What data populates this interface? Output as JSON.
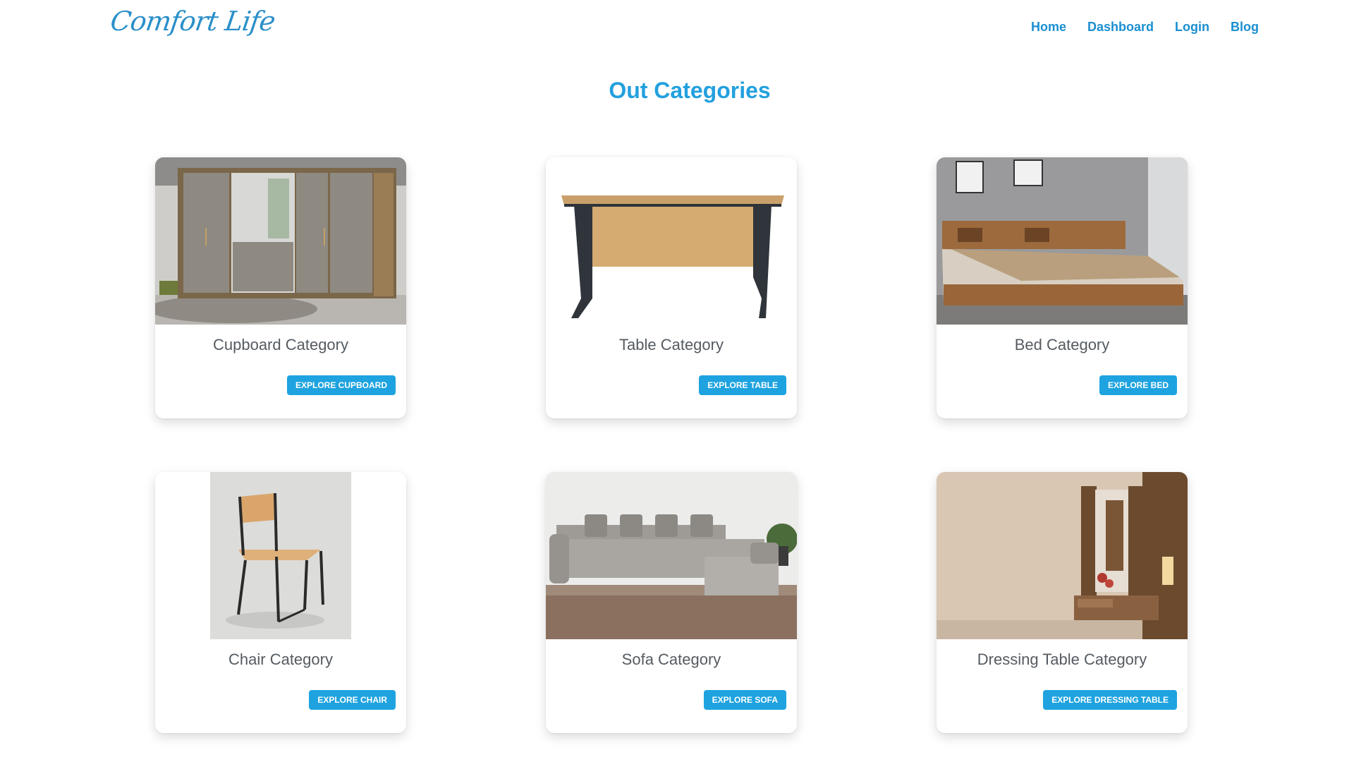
{
  "header": {
    "brand": "Comfort Life",
    "nav": [
      "Home",
      "Dashboard",
      "Login",
      "Blog"
    ]
  },
  "page": {
    "title": "Out Categories"
  },
  "categories": [
    {
      "title": "Cupboard Category",
      "button": "EXPLORE CUPBOARD",
      "image": "cupboard-image"
    },
    {
      "title": "Table Category",
      "button": "EXPLORE TABLE",
      "image": "table-image"
    },
    {
      "title": "Bed Category",
      "button": "EXPLORE BED",
      "image": "bed-image"
    },
    {
      "title": "Chair Category",
      "button": "EXPLORE CHAIR",
      "image": "chair-image"
    },
    {
      "title": "Sofa Category",
      "button": "EXPLORE SOFA",
      "image": "sofa-image"
    },
    {
      "title": "Dressing Table Category",
      "button": "EXPLORE DRESSING TABLE",
      "image": "dressing-table-image"
    }
  ],
  "colors": {
    "accent": "#1ea3e0",
    "nav_link": "#1a8fd0",
    "card_title": "#555b61"
  }
}
